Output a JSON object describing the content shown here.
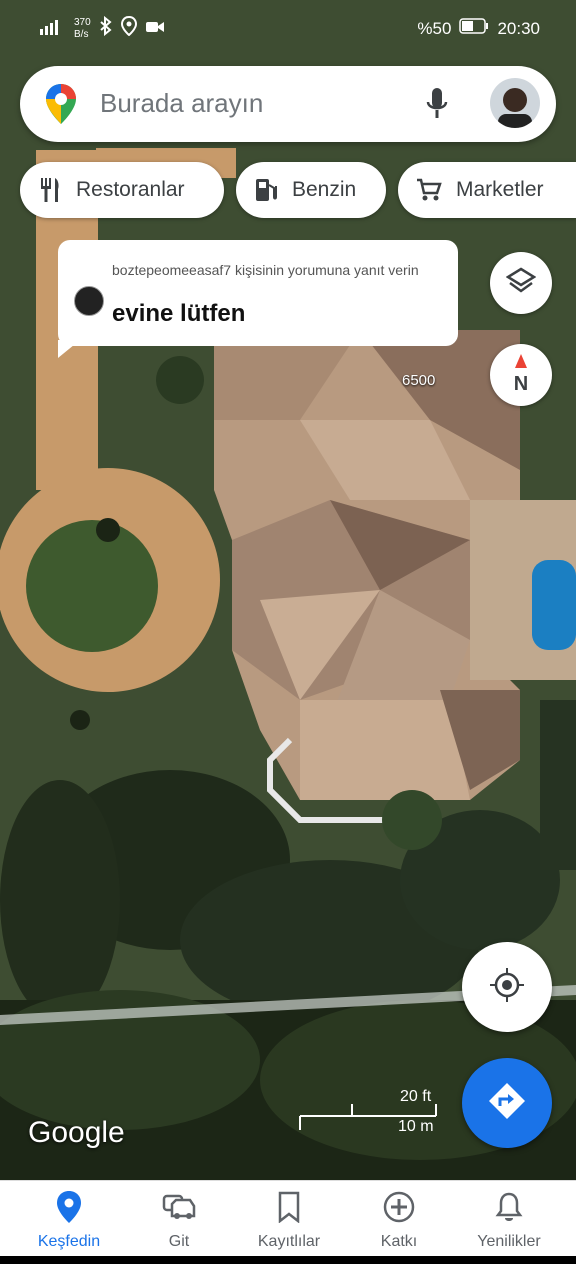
{
  "status_bar": {
    "network_speed": "370\nB/s",
    "battery": "%50",
    "time": "20:30"
  },
  "search": {
    "placeholder": "Burada arayın"
  },
  "chips": [
    {
      "label": "Restoranlar",
      "icon": "fork-knife-icon"
    },
    {
      "label": "Benzin",
      "icon": "gas-pump-icon"
    },
    {
      "label": "Marketler",
      "icon": "cart-icon"
    }
  ],
  "comment_overlay": {
    "meta": "boztepeomeeasaf7 kişisinin yorumuna yanıt verin",
    "text": "evine lütfen"
  },
  "map": {
    "house_number": "6500",
    "compass_letter": "N",
    "scale_feet": "20 ft",
    "scale_meters": "10 m",
    "logo": "Google"
  },
  "tabs": [
    {
      "label": "Keşfedin",
      "icon": "pin-icon",
      "active": true
    },
    {
      "label": "Git",
      "icon": "car-icon",
      "active": false
    },
    {
      "label": "Kayıtlılar",
      "icon": "bookmark-icon",
      "active": false
    },
    {
      "label": "Katkı",
      "icon": "plus-circle-icon",
      "active": false
    },
    {
      "label": "Yenilikler",
      "icon": "bell-icon",
      "active": false
    }
  ],
  "colors": {
    "accent": "#1a73e8",
    "map_grass": "#3b4a30",
    "roof": "#b89a80",
    "path": "#c79a6a"
  }
}
